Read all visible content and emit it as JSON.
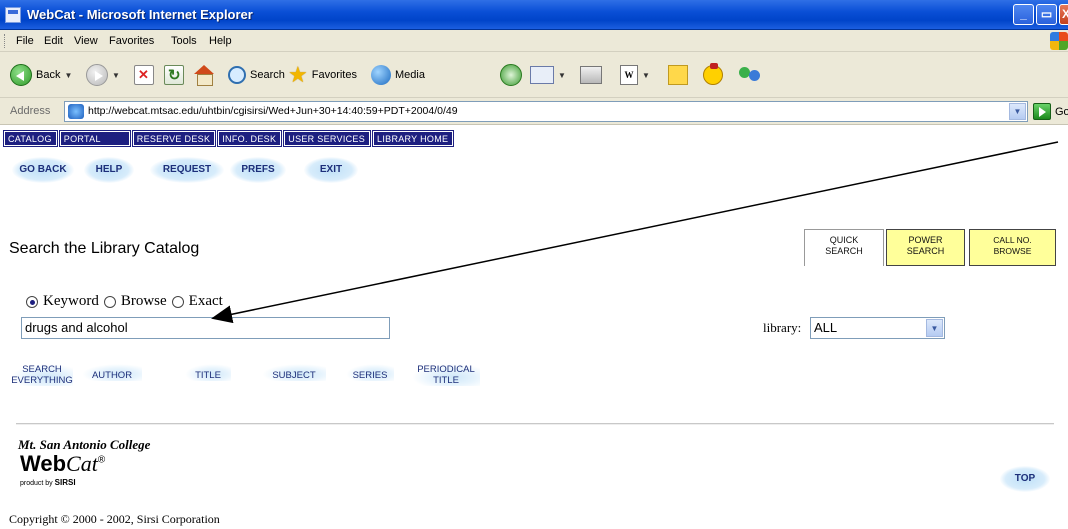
{
  "window": {
    "title": "WebCat - Microsoft Internet Explorer",
    "buttons": {
      "minimize": "_",
      "maximize": "▭",
      "close": "X"
    }
  },
  "menu": [
    "File",
    "Edit",
    "View",
    "Favorites",
    "Tools",
    "Help"
  ],
  "toolbar": {
    "back": "Back",
    "search": "Search",
    "favorites": "Favorites",
    "media": "Media",
    "word_icon": "W"
  },
  "address": {
    "label": "Address",
    "url": "http://webcat.mtsac.edu/uhtbin/cgisirsi/Wed+Jun+30+14:40:59+PDT+2004/0/49",
    "go": "Go"
  },
  "nav_tabs": [
    "CATALOG",
    "PORTAL",
    "RESERVE DESK",
    "INFO. DESK",
    "USER SERVICES",
    "LIBRARY HOME"
  ],
  "action_buttons": [
    "GO BACK",
    "HELP",
    "REQUEST",
    "PREFS",
    "EXIT"
  ],
  "heading": "Search the Library Catalog",
  "search_tabs": {
    "quick": [
      "QUICK",
      "SEARCH"
    ],
    "power": [
      "POWER",
      "SEARCH"
    ],
    "callno": [
      "CALL NO.",
      "BROWSE"
    ]
  },
  "search_type": {
    "options": [
      "Keyword",
      "Browse",
      "Exact"
    ],
    "selected": "Keyword"
  },
  "search_input": {
    "value": "drugs and alcohol"
  },
  "library": {
    "label": "library:",
    "value": "ALL"
  },
  "search_buttons": [
    [
      "SEARCH",
      "EVERYTHING"
    ],
    [
      "AUTHOR"
    ],
    [
      "TITLE"
    ],
    [
      "SUBJECT"
    ],
    [
      "SERIES"
    ],
    [
      "PERIODICAL",
      "TITLE"
    ]
  ],
  "footer": {
    "college": "Mt. San Antonio College",
    "logo_bold": "Web",
    "logo_italic": "Cat",
    "logo_mark": "®",
    "product_by": "product by",
    "sirsi": "SIRSI",
    "top": "TOP",
    "copyright": "Copyright © 2000 - 2002, Sirsi Corporation"
  },
  "colors": {
    "nav_tab_bg": "#1d1f80",
    "pill_text": "#1d2f7a",
    "tab_yellow": "#ffff9a",
    "title_bar": "#0a4fd6"
  },
  "icons": [
    "ie-icon",
    "back-icon",
    "forward-icon",
    "stop-icon",
    "refresh-icon",
    "home-icon",
    "search-icon",
    "favorites-star-icon",
    "media-icon",
    "history-icon",
    "mail-icon",
    "print-icon",
    "word-icon",
    "notes-icon",
    "messenger-icon",
    "windows-flag-icon",
    "go-arrow-icon",
    "annotation-arrow-icon"
  ]
}
